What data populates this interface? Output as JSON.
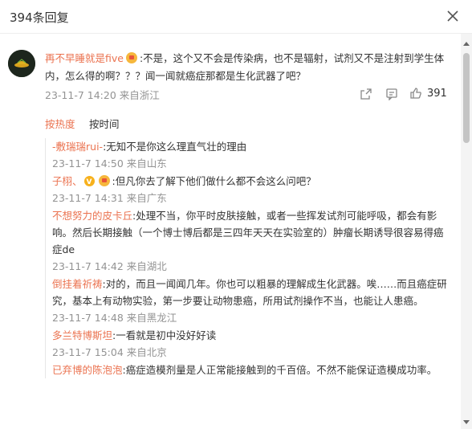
{
  "header": {
    "title": "394条回复"
  },
  "main_comment": {
    "user": "再不早睡就是five",
    "text": ":不是，这个又不会是传染病，也不是辐射，试剂又不是注射到学生体内，怎么得的啊？？？闻一闻就癌症那都是生化武器了吧？",
    "meta": "23-11-7 14:20 来自浙江",
    "like_count": "391"
  },
  "sort": {
    "hot": "按热度",
    "time": "按时间"
  },
  "replies": [
    {
      "user": "-敷瑞瑞rui-",
      "text": ":无知不是你这么理直气壮的理由",
      "meta": "23-11-7 14:50 来自山东"
    },
    {
      "user": "子栩、",
      "text": ":但凡你去了解下他们做什么都不会这么问吧？",
      "meta": "23-11-7 14:31 来自广东"
    },
    {
      "user": "不想努力的皮卡丘",
      "text": ":处理不当，你平时皮肤接触，或者一些挥发试剂可能呼吸，都会有影响。然后长期接触（一个博士博后都是三四年天天在实验室的）肿瘤长期诱导很容易得癌症de",
      "meta": "23-11-7 14:42 来自湖北"
    },
    {
      "user": "倒挂着祈祷",
      "text": ":对的，而且一闻闻几年。你也可以粗暴的理解成生化武器。唉……而且癌症研究，基本上有动物实验，第一步要让动物患癌，所用试剂操作不当，也能让人患癌。",
      "meta": "23-11-7 14:48 来自黑龙江"
    },
    {
      "user": "多兰特博斯坦",
      "text": ":一看就是初中没好好读",
      "meta": "23-11-7 15:04 来自北京"
    },
    {
      "user": "已弃博的陈泡泡",
      "text": ":癌症造模剂量是人正常能接触到的千百倍。不然不能保证造模成功率。",
      "meta": ""
    }
  ]
}
